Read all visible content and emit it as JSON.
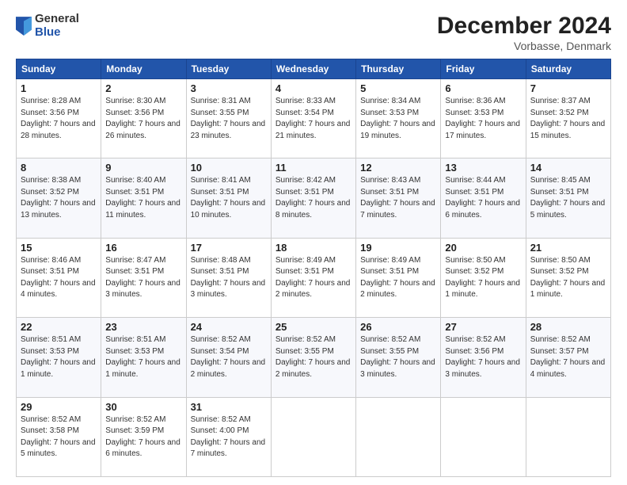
{
  "header": {
    "logo": {
      "general": "General",
      "blue": "Blue"
    },
    "title": "December 2024",
    "location": "Vorbasse, Denmark"
  },
  "calendar": {
    "weekdays": [
      "Sunday",
      "Monday",
      "Tuesday",
      "Wednesday",
      "Thursday",
      "Friday",
      "Saturday"
    ],
    "weeks": [
      [
        {
          "day": "1",
          "sunrise": "Sunrise: 8:28 AM",
          "sunset": "Sunset: 3:56 PM",
          "daylight": "Daylight: 7 hours and 28 minutes."
        },
        {
          "day": "2",
          "sunrise": "Sunrise: 8:30 AM",
          "sunset": "Sunset: 3:56 PM",
          "daylight": "Daylight: 7 hours and 26 minutes."
        },
        {
          "day": "3",
          "sunrise": "Sunrise: 8:31 AM",
          "sunset": "Sunset: 3:55 PM",
          "daylight": "Daylight: 7 hours and 23 minutes."
        },
        {
          "day": "4",
          "sunrise": "Sunrise: 8:33 AM",
          "sunset": "Sunset: 3:54 PM",
          "daylight": "Daylight: 7 hours and 21 minutes."
        },
        {
          "day": "5",
          "sunrise": "Sunrise: 8:34 AM",
          "sunset": "Sunset: 3:53 PM",
          "daylight": "Daylight: 7 hours and 19 minutes."
        },
        {
          "day": "6",
          "sunrise": "Sunrise: 8:36 AM",
          "sunset": "Sunset: 3:53 PM",
          "daylight": "Daylight: 7 hours and 17 minutes."
        },
        {
          "day": "7",
          "sunrise": "Sunrise: 8:37 AM",
          "sunset": "Sunset: 3:52 PM",
          "daylight": "Daylight: 7 hours and 15 minutes."
        }
      ],
      [
        {
          "day": "8",
          "sunrise": "Sunrise: 8:38 AM",
          "sunset": "Sunset: 3:52 PM",
          "daylight": "Daylight: 7 hours and 13 minutes."
        },
        {
          "day": "9",
          "sunrise": "Sunrise: 8:40 AM",
          "sunset": "Sunset: 3:51 PM",
          "daylight": "Daylight: 7 hours and 11 minutes."
        },
        {
          "day": "10",
          "sunrise": "Sunrise: 8:41 AM",
          "sunset": "Sunset: 3:51 PM",
          "daylight": "Daylight: 7 hours and 10 minutes."
        },
        {
          "day": "11",
          "sunrise": "Sunrise: 8:42 AM",
          "sunset": "Sunset: 3:51 PM",
          "daylight": "Daylight: 7 hours and 8 minutes."
        },
        {
          "day": "12",
          "sunrise": "Sunrise: 8:43 AM",
          "sunset": "Sunset: 3:51 PM",
          "daylight": "Daylight: 7 hours and 7 minutes."
        },
        {
          "day": "13",
          "sunrise": "Sunrise: 8:44 AM",
          "sunset": "Sunset: 3:51 PM",
          "daylight": "Daylight: 7 hours and 6 minutes."
        },
        {
          "day": "14",
          "sunrise": "Sunrise: 8:45 AM",
          "sunset": "Sunset: 3:51 PM",
          "daylight": "Daylight: 7 hours and 5 minutes."
        }
      ],
      [
        {
          "day": "15",
          "sunrise": "Sunrise: 8:46 AM",
          "sunset": "Sunset: 3:51 PM",
          "daylight": "Daylight: 7 hours and 4 minutes."
        },
        {
          "day": "16",
          "sunrise": "Sunrise: 8:47 AM",
          "sunset": "Sunset: 3:51 PM",
          "daylight": "Daylight: 7 hours and 3 minutes."
        },
        {
          "day": "17",
          "sunrise": "Sunrise: 8:48 AM",
          "sunset": "Sunset: 3:51 PM",
          "daylight": "Daylight: 7 hours and 3 minutes."
        },
        {
          "day": "18",
          "sunrise": "Sunrise: 8:49 AM",
          "sunset": "Sunset: 3:51 PM",
          "daylight": "Daylight: 7 hours and 2 minutes."
        },
        {
          "day": "19",
          "sunrise": "Sunrise: 8:49 AM",
          "sunset": "Sunset: 3:51 PM",
          "daylight": "Daylight: 7 hours and 2 minutes."
        },
        {
          "day": "20",
          "sunrise": "Sunrise: 8:50 AM",
          "sunset": "Sunset: 3:52 PM",
          "daylight": "Daylight: 7 hours and 1 minute."
        },
        {
          "day": "21",
          "sunrise": "Sunrise: 8:50 AM",
          "sunset": "Sunset: 3:52 PM",
          "daylight": "Daylight: 7 hours and 1 minute."
        }
      ],
      [
        {
          "day": "22",
          "sunrise": "Sunrise: 8:51 AM",
          "sunset": "Sunset: 3:53 PM",
          "daylight": "Daylight: 7 hours and 1 minute."
        },
        {
          "day": "23",
          "sunrise": "Sunrise: 8:51 AM",
          "sunset": "Sunset: 3:53 PM",
          "daylight": "Daylight: 7 hours and 1 minute."
        },
        {
          "day": "24",
          "sunrise": "Sunrise: 8:52 AM",
          "sunset": "Sunset: 3:54 PM",
          "daylight": "Daylight: 7 hours and 2 minutes."
        },
        {
          "day": "25",
          "sunrise": "Sunrise: 8:52 AM",
          "sunset": "Sunset: 3:55 PM",
          "daylight": "Daylight: 7 hours and 2 minutes."
        },
        {
          "day": "26",
          "sunrise": "Sunrise: 8:52 AM",
          "sunset": "Sunset: 3:55 PM",
          "daylight": "Daylight: 7 hours and 3 minutes."
        },
        {
          "day": "27",
          "sunrise": "Sunrise: 8:52 AM",
          "sunset": "Sunset: 3:56 PM",
          "daylight": "Daylight: 7 hours and 3 minutes."
        },
        {
          "day": "28",
          "sunrise": "Sunrise: 8:52 AM",
          "sunset": "Sunset: 3:57 PM",
          "daylight": "Daylight: 7 hours and 4 minutes."
        }
      ],
      [
        {
          "day": "29",
          "sunrise": "Sunrise: 8:52 AM",
          "sunset": "Sunset: 3:58 PM",
          "daylight": "Daylight: 7 hours and 5 minutes."
        },
        {
          "day": "30",
          "sunrise": "Sunrise: 8:52 AM",
          "sunset": "Sunset: 3:59 PM",
          "daylight": "Daylight: 7 hours and 6 minutes."
        },
        {
          "day": "31",
          "sunrise": "Sunrise: 8:52 AM",
          "sunset": "Sunset: 4:00 PM",
          "daylight": "Daylight: 7 hours and 7 minutes."
        },
        null,
        null,
        null,
        null
      ]
    ]
  }
}
